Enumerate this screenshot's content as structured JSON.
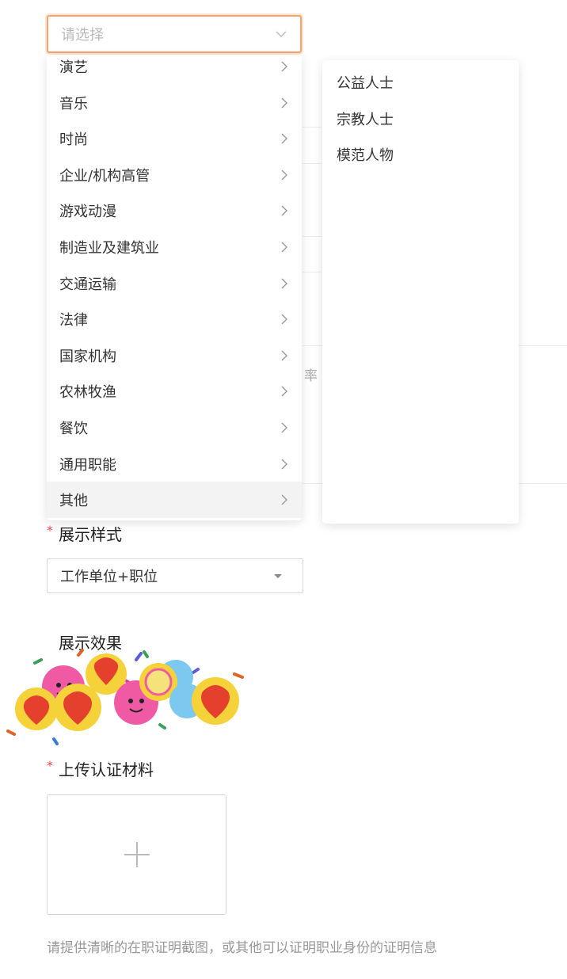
{
  "select": {
    "placeholder": "请选择",
    "icon": "chevron-down-icon"
  },
  "menu_level1": {
    "items": [
      {
        "label": "演艺"
      },
      {
        "label": "音乐"
      },
      {
        "label": "时尚"
      },
      {
        "label": "企业/机构高管"
      },
      {
        "label": "游戏动漫"
      },
      {
        "label": "制造业及建筑业"
      },
      {
        "label": "交通运输"
      },
      {
        "label": "法律"
      },
      {
        "label": "国家机构"
      },
      {
        "label": "农林牧渔"
      },
      {
        "label": "餐饮"
      },
      {
        "label": "通用职能"
      },
      {
        "label": "其他",
        "active": true
      }
    ],
    "arrow_icon": "chevron-right-icon"
  },
  "menu_level2": {
    "items": [
      {
        "label": "公益人士"
      },
      {
        "label": "宗教人士"
      },
      {
        "label": "模范人物"
      }
    ]
  },
  "background_fragment": "率",
  "display_style": {
    "label": "展示样式",
    "required_mark": "*",
    "value": "工作单位+职位"
  },
  "display_effect": {
    "label": "展示效果",
    "sticker": "candy-heart-stickers"
  },
  "upload": {
    "label": "上传认证材料",
    "required_mark": "*",
    "icon": "plus-icon",
    "hint": "请提供清晰的在职证明截图，或其他可以证明职业身份的证明信息"
  },
  "colors": {
    "focus_border": "#f6a36e",
    "required": "#e5484d",
    "active_item_bg": "#f3f3f3"
  }
}
